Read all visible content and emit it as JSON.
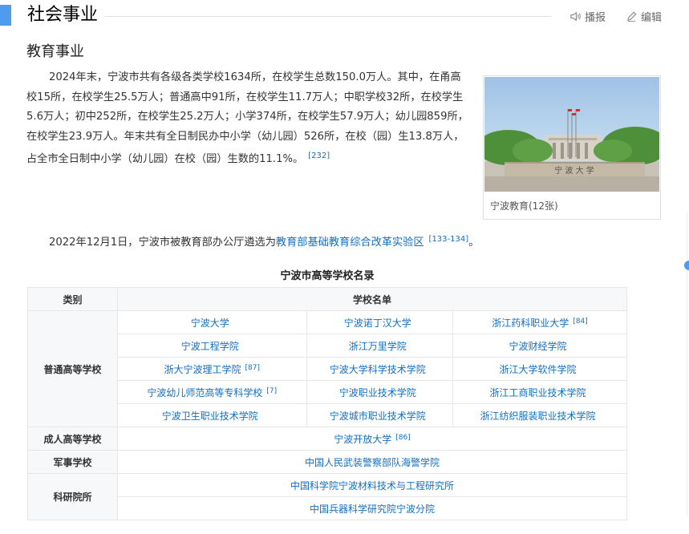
{
  "header": {
    "title": "社会事业",
    "report_label": "播报",
    "edit_label": "编辑"
  },
  "subtitle": "教育事业",
  "para1": {
    "text": "2024年末，宁波市共有各级各类学校1634所，在校学生总数150.0万人。其中，在甬高校15所，在校学生25.5万人；普通高中91所，在校学生11.7万人；中职学校32所，在校学生5.6万人；初中252所，在校学生25.2万人；小学374所，在校学生57.9万人；幼儿园859所，在校学生23.9万人。年末共有全日制民办中小学（幼儿园）526所，在校（园）生13.8万人，占全市全日制中小学（幼儿园）在校（园）生数的11.1%。",
    "ref": "[232]"
  },
  "para2": {
    "before": "2022年12月1日，宁波市被教育部办公厅遴选为",
    "link": "教育部基础教育综合改革实验区",
    "ref": "[133-134]",
    "after": "。"
  },
  "image_card": {
    "caption": "宁波教育(12张)",
    "gate_text": "宁 波 大 学"
  },
  "table": {
    "title": "宁波市高等学校名录",
    "col_category": "类别",
    "col_names": "学校名单",
    "general_label": "普通高等学校",
    "general_rows": [
      [
        {
          "name": "宁波大学",
          "ref": ""
        },
        {
          "name": "宁波诺丁汉大学",
          "ref": ""
        },
        {
          "name": "浙江药科职业大学",
          "ref": "[84]"
        }
      ],
      [
        {
          "name": "宁波工程学院",
          "ref": ""
        },
        {
          "name": "浙江万里学院",
          "ref": ""
        },
        {
          "name": "宁波财经学院",
          "ref": ""
        }
      ],
      [
        {
          "name": "浙大宁波理工学院",
          "ref": "[87]"
        },
        {
          "name": "宁波大学科学技术学院",
          "ref": ""
        },
        {
          "name": "浙江大学软件学院",
          "ref": ""
        }
      ],
      [
        {
          "name": "宁波幼儿师范高等专科学校",
          "ref": "[7]"
        },
        {
          "name": "宁波职业技术学院",
          "ref": ""
        },
        {
          "name": "浙江工商职业技术学院",
          "ref": ""
        }
      ],
      [
        {
          "name": "宁波卫生职业技术学院",
          "ref": ""
        },
        {
          "name": "宁波城市职业技术学院",
          "ref": ""
        },
        {
          "name": "浙江纺织服装职业技术学院",
          "ref": ""
        }
      ]
    ],
    "adult_label": "成人高等学校",
    "adult_school": "宁波开放大学",
    "adult_ref": "[86]",
    "military_label": "军事学校",
    "military_school": "中国人民武装警察部队海警学院",
    "research_label": "科研院所",
    "research_1": "中国科学院宁波材料技术与工程研究所",
    "research_2": "中国兵器科学研究院宁波分院"
  },
  "colors": {
    "accent": "#4f9cee",
    "link": "#136ec2",
    "header_bg": "#f7f8fa"
  }
}
